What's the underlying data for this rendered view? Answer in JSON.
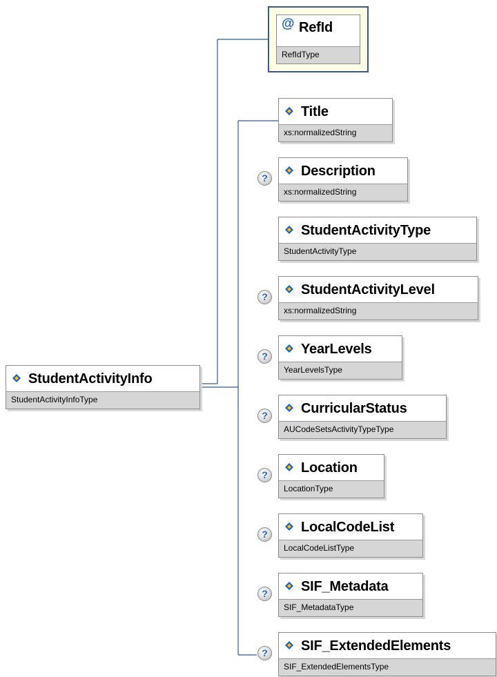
{
  "root": {
    "name": "StudentActivityInfo",
    "type": "StudentActivityInfoType"
  },
  "attribute": {
    "symbol": "@",
    "name": "RefId",
    "type": "RefIdType"
  },
  "children": [
    {
      "name": "Title",
      "type": "xs:normalizedString",
      "optional": false
    },
    {
      "name": "Description",
      "type": "xs:normalizedString",
      "optional": true
    },
    {
      "name": "StudentActivityType",
      "type": "StudentActivityType",
      "optional": false
    },
    {
      "name": "StudentActivityLevel",
      "type": "xs:normalizedString",
      "optional": true
    },
    {
      "name": "YearLevels",
      "type": "YearLevelsType",
      "optional": true
    },
    {
      "name": "CurricularStatus",
      "type": "AUCodeSetsActivityTypeType",
      "optional": true
    },
    {
      "name": "Location",
      "type": "LocationType",
      "optional": true
    },
    {
      "name": "LocalCodeList",
      "type": "LocalCodeListType",
      "optional": true
    },
    {
      "name": "SIF_Metadata",
      "type": "SIF_MetadataType",
      "optional": true
    },
    {
      "name": "SIF_ExtendedElements",
      "type": "SIF_ExtendedElementsType",
      "optional": true
    }
  ],
  "optional_marker": "?",
  "colors": {
    "connector": "#2f5a8a",
    "type_band": "#d6d6d6",
    "icon_blue": "#1f5fbf",
    "icon_yellow": "#f2c21a"
  }
}
